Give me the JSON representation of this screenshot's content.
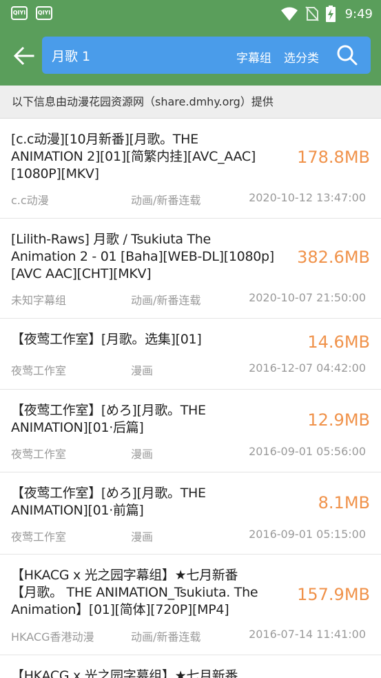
{
  "status_bar": {
    "left_icons": [
      "QIYI",
      "QIYI"
    ],
    "time": "9:49",
    "icons": [
      "wifi-icon",
      "no-sim-icon",
      "battery-charging-icon"
    ]
  },
  "app_bar": {
    "search_value": "月歌 1",
    "subtitle_group_label": "字幕组",
    "category_label": "选分类",
    "colors": {
      "bar": "#5a9e5b",
      "search": "#4a9cea",
      "size": "#f0924a"
    }
  },
  "info_text": "以下信息由动漫花园资源网（share.dmhy.org）提供",
  "results": [
    {
      "title_lines": [
        "[c.c动漫][10月新番][月歌。THE",
        "ANIMATION 2][01][简繁内挂][AVC_AAC]",
        "[1080P][MKV]"
      ],
      "size": "178.8MB",
      "group": "c.c动漫",
      "category": "动画/新番连载",
      "date": "2020-10-12 13:47:00"
    },
    {
      "title_lines": [
        "[Lilith-Raws] 月歌 / Tsukiuta The",
        "Animation 2 - 01 [Baha][WEB-DL][1080p]",
        "[AVC AAC][CHT][MKV]"
      ],
      "size": "382.6MB",
      "group": "未知字幕组",
      "category": "动画/新番连载",
      "date": "2020-10-07 21:50:00"
    },
    {
      "title_lines": [
        "【夜莺工作室】[月歌。选集][01]"
      ],
      "size": "14.6MB",
      "group": "夜莺工作室",
      "category": "漫画",
      "date": "2016-12-07 04:42:00"
    },
    {
      "title_lines": [
        "【夜莺工作室】[めろ][月歌。THE",
        "ANIMATION][01·后篇]"
      ],
      "size": "12.9MB",
      "group": "夜莺工作室",
      "category": "漫画",
      "date": "2016-09-01 05:56:00"
    },
    {
      "title_lines": [
        "【夜莺工作室】[めろ][月歌。THE",
        "ANIMATION][01·前篇]"
      ],
      "size": "8.1MB",
      "group": "夜莺工作室",
      "category": "漫画",
      "date": "2016-09-01 05:15:00"
    },
    {
      "title_lines": [
        "【HKACG x 光之园字幕组】★七月新番",
        "【月歌。 THE ANIMATION_Tsukiuta. The",
        "Animation】[01][简体][720P][MP4]"
      ],
      "size": "157.9MB",
      "group": "HKACG香港动漫",
      "category": "动画/新番连载",
      "date": "2016-07-14 11:41:00"
    },
    {
      "title_lines": [
        "【HKACG x 光之园字幕组】★七月新番"
      ],
      "size": "",
      "group": "",
      "category": "",
      "date": ""
    }
  ]
}
